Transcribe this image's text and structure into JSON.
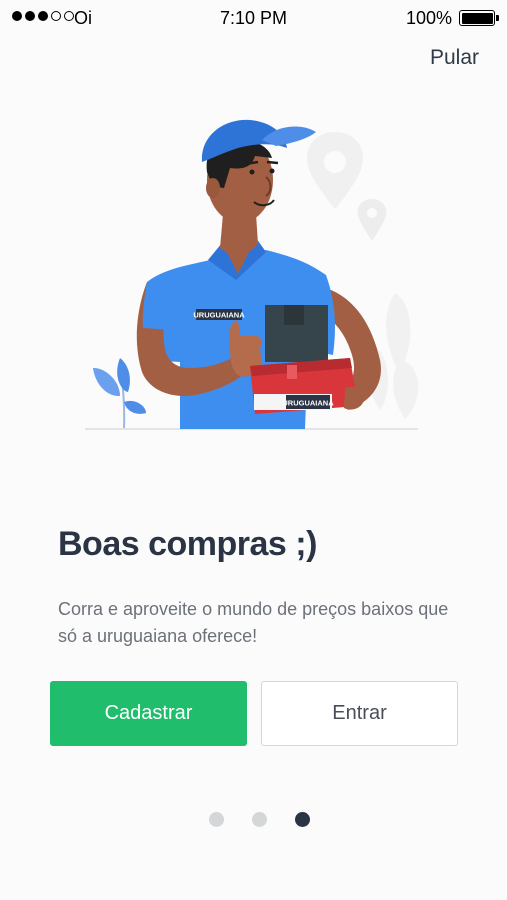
{
  "status_bar": {
    "carrier": "Oi",
    "time": "7:10 PM",
    "battery_percent": "100%",
    "signal_bars": 3,
    "signal_total": 5
  },
  "header": {
    "skip_label": "Pular"
  },
  "illustration": {
    "icon": "delivery-person-illustration",
    "shirt_badge": "URUGUAIANA",
    "box_label": "URUGUAIANA"
  },
  "onboarding": {
    "title": "Boas compras ;)",
    "subtitle": "Corra e aproveite o mundo de preços baixos que só a uruguaiana oferece!"
  },
  "actions": {
    "register_label": "Cadastrar",
    "login_label": "Entrar"
  },
  "pager": {
    "total": 3,
    "current": 3
  },
  "colors": {
    "accent_green": "#1fbd6c",
    "title": "#2b3444",
    "uniform_blue": "#3e8ef0",
    "box_red": "#d8363b"
  }
}
